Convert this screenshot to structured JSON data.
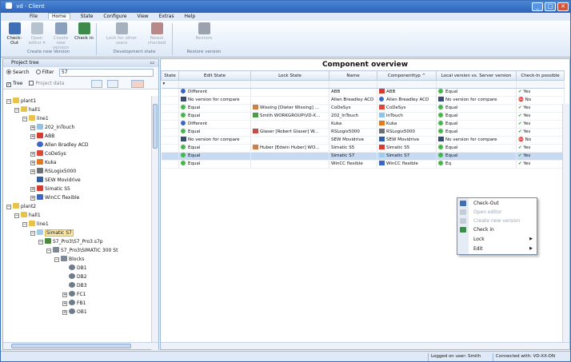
{
  "window": {
    "title": "vd · Client"
  },
  "menu": [
    "File",
    "Home",
    "State",
    "Configure",
    "View",
    "Extras",
    "Help"
  ],
  "ribbon": {
    "buttons": [
      {
        "label": "Check-Out",
        "color": "#3f6fb5"
      },
      {
        "label": "Open editor ▾",
        "color": "#b7c2cf"
      },
      {
        "label": "Create new version",
        "color": "#8aa0bd"
      },
      {
        "label": "Check in",
        "color": "#3e8a4b"
      },
      {
        "label": "Lock for other users",
        "color": "#a6b1bf"
      },
      {
        "label": "Newsl checked",
        "color": "#b8898a"
      },
      {
        "label": "Restore",
        "color": "#9aa3ad"
      }
    ],
    "groups": [
      "Create new Version",
      "Development state",
      "Restore version"
    ]
  },
  "left": {
    "header": "Project tree",
    "search_label": "Search",
    "filter_label": "Filter",
    "filter_value": "57",
    "tree_label": "Tree",
    "project_data_label": "Project data",
    "nodes": [
      "plant1",
      "hall1",
      "line1",
      "202_InTouch",
      "ABB",
      "Allen Bradley ACD",
      "CoDeSys",
      "Kuka",
      "RSLogix5000",
      "SEW Movidrive",
      "Simatic S5",
      "WinCC flexible",
      "plant2",
      "hall1",
      "line1",
      "Simatic S7",
      "S7_Pro3\\S7_Pro3.s7p",
      "S7_Pro3\\SIMATIC 300 St",
      "Blocks",
      "DB1",
      "DB2",
      "DB3",
      "FC1",
      "FB1",
      "OB1"
    ]
  },
  "main": {
    "title": "Component overview",
    "columns": [
      "State",
      "Edit State",
      "Lock State",
      "Name",
      "Componenttyp ^",
      "Local version vs. Server version",
      "Check-In possible"
    ],
    "rows": [
      {
        "edit": "Different",
        "lock": "",
        "name": "ABB",
        "type": "ABB",
        "local": "Equal",
        "checkin": "Yes"
      },
      {
        "edit": "No version for compare",
        "lock": "",
        "name": "Allen Breadley ACD",
        "type": "Allen Breadley ACD",
        "local": "No version for compare",
        "checkin": "No"
      },
      {
        "edit": "Equal",
        "lock": "Wissing [Dieter Wissing] ...",
        "name": "CoDeSys",
        "type": "CoDeSys",
        "local": "Equal",
        "checkin": "Yes"
      },
      {
        "edit": "Equal",
        "lock": "Smith WORKGROUP\\VD-X...",
        "name": "202_InTouch",
        "type": "InTouch",
        "local": "Equal",
        "checkin": "Yes"
      },
      {
        "edit": "Different",
        "lock": "",
        "name": "Kuka",
        "type": "Kuka",
        "local": "Equal",
        "checkin": "Yes"
      },
      {
        "edit": "Equal",
        "lock": "Glaser [Robert Glaser] W...",
        "name": "RSLogix5000",
        "type": "RSLogix5000",
        "local": "Equal",
        "checkin": "Yes"
      },
      {
        "edit": "No version for compare",
        "lock": "",
        "name": "SEW Movidrive",
        "type": "SEW Movidrive",
        "local": "No version for compare",
        "checkin": "No"
      },
      {
        "edit": "Equal",
        "lock": "Huber [Edwin Huber] WO...",
        "name": "Simatic S5",
        "type": "Simatic S5",
        "local": "Equal",
        "checkin": "Yes"
      },
      {
        "edit": "Equal",
        "lock": "",
        "name": "Simatic S7",
        "type": "Simatic S7",
        "local": "Equal",
        "checkin": "Yes"
      },
      {
        "edit": "Equal",
        "lock": "",
        "name": "WinCC flexible",
        "type": "WinCC flexible",
        "local": "Eq",
        "checkin": "Yes"
      }
    ]
  },
  "context_menu": {
    "items": [
      "Check-Out",
      "Open editor",
      "Create new version",
      "Check in",
      "Lock",
      "Edit"
    ]
  },
  "status": {
    "user": "Logged on user: Smith",
    "connection": "Connected with: VD-XX-DN"
  }
}
